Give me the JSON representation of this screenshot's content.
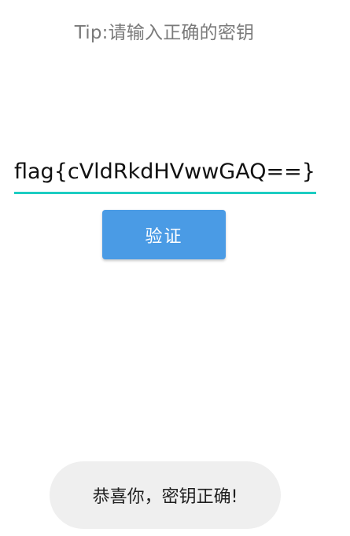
{
  "tip": "Tip:请输入正确的密钥",
  "key_input": {
    "value": "flag{cVldRkdHVwwGAQ==}",
    "accent_color": "#1dcdc2"
  },
  "verify_button": {
    "label": "验证",
    "color": "#4a9be5"
  },
  "toast": {
    "message": "恭喜你，密钥正确!"
  }
}
